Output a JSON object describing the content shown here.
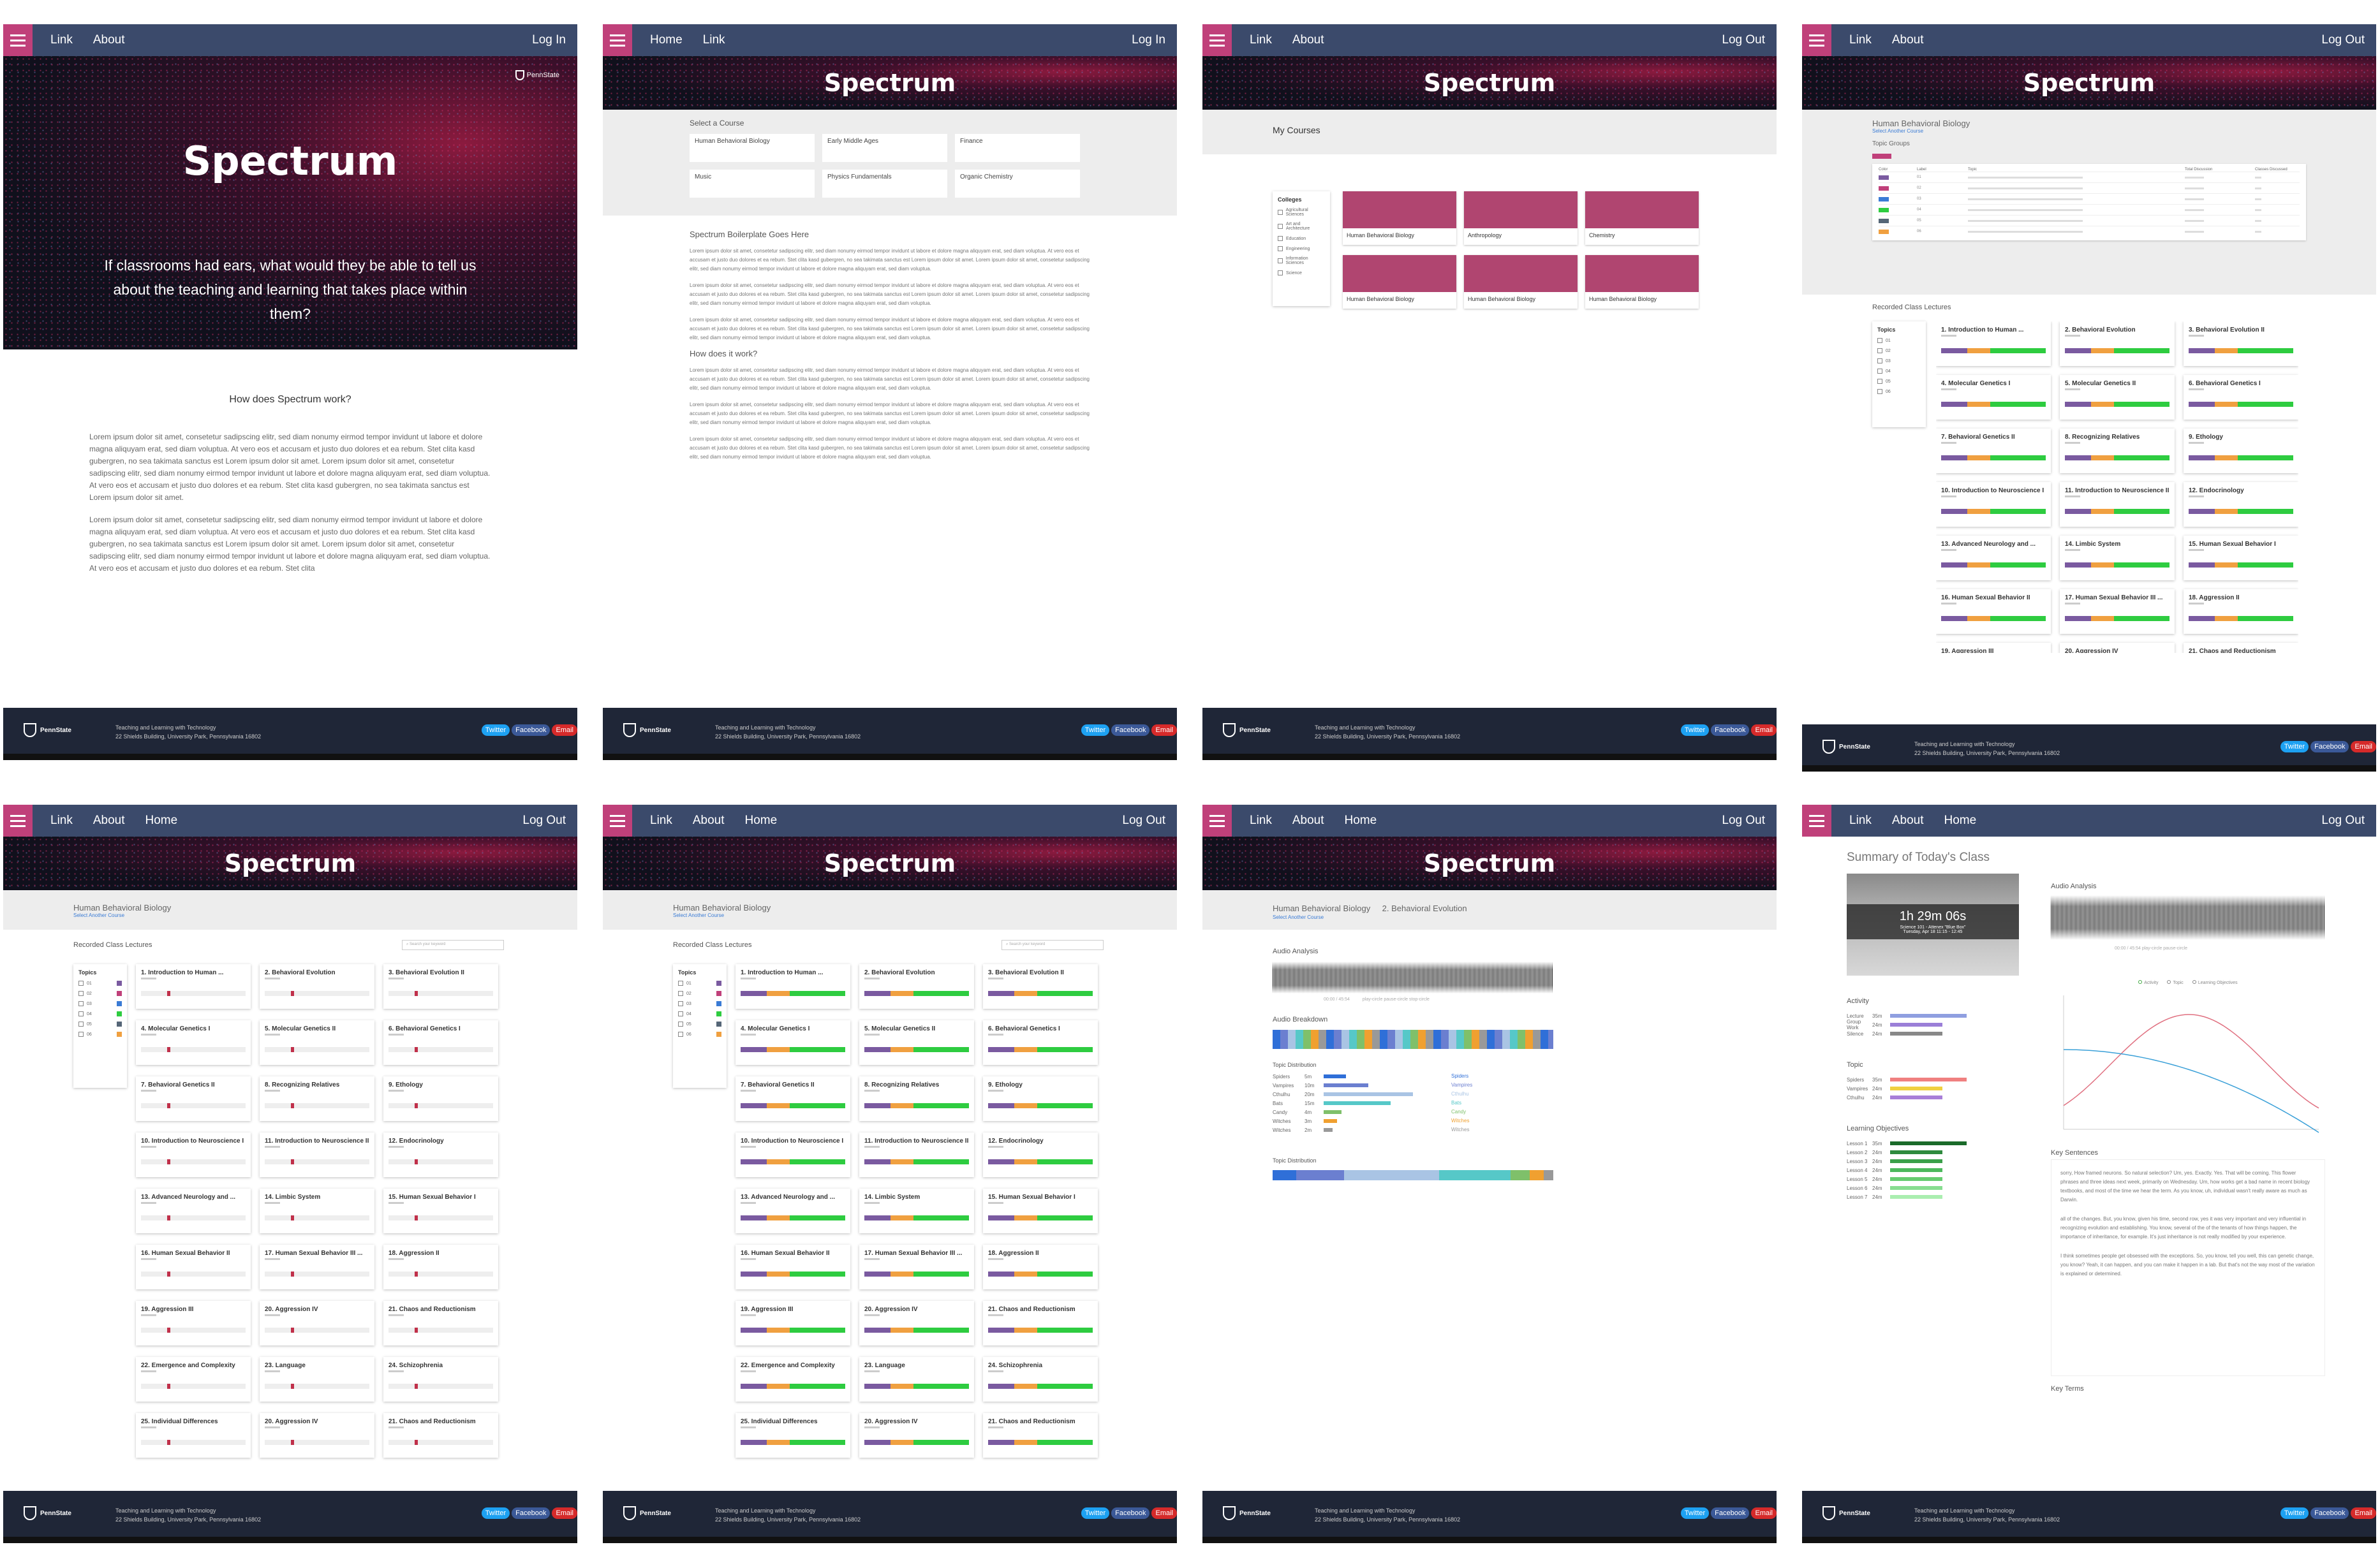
{
  "nav": {
    "link": "Link",
    "about": "About",
    "home": "Home",
    "login": "Log In",
    "logout": "Log Out"
  },
  "brand": {
    "title": "Spectrum",
    "psu": "PennState"
  },
  "hero": {
    "tagline": "If classrooms had ears, what would they be able to tell us about the teaching and learning that takes place within them?"
  },
  "landing": {
    "how_heading": "How does Spectrum work?",
    "para": "Lorem ipsum dolor sit amet, consetetur sadipscing elitr, sed diam nonumy eirmod tempor invidunt ut labore et dolore magna aliquyam erat, sed diam voluptua. At vero eos et accusam et justo duo dolores et ea rebum. Stet clita kasd gubergren, no sea takimata sanctus est Lorem ipsum dolor sit amet. Lorem ipsum dolor sit amet, consetetur sadipscing elitr, sed diam nonumy eirmod tempor invidunt ut labore et dolore magna aliquyam erat, sed diam voluptua. At vero eos et accusam et justo duo dolores et ea rebum. Stet clita kasd gubergren, no sea takimata sanctus est Lorem ipsum dolor sit amet.",
    "para2": "Lorem ipsum dolor sit amet, consetetur sadipscing elitr, sed diam nonumy eirmod tempor invidunt ut labore et dolore magna aliquyam erat, sed diam voluptua. At vero eos et accusam et justo duo dolores et ea rebum. Stet clita kasd gubergren, no sea takimata sanctus est Lorem ipsum dolor sit amet. Lorem ipsum dolor sit amet, consetetur sadipscing elitr, sed diam nonumy eirmod tempor invidunt ut labore et dolore magna aliquyam erat, sed diam voluptua. At vero eos et accusam et justo duo dolores et ea rebum. Stet clita"
  },
  "courses": {
    "select_label": "Select a Course",
    "items": [
      "Human Behavioral Biology",
      "Early Middle Ages",
      "Finance",
      "Music",
      "Physics Fundamentals",
      "Organic Chemistry"
    ],
    "boiler_heading": "Spectrum Boilerplate Goes Here",
    "how_heading": "How does it work?",
    "lorem": "Lorem ipsum dolor sit amet, consetetur sadipscing elitr, sed diam nonumy eirmod tempor invidunt ut labore et dolore magna aliquyam erat, sed diam voluptua. At vero eos et accusam et justo duo dolores et ea rebum. Stet clita kasd gubergren, no sea takimata sanctus est Lorem ipsum dolor sit amet. Lorem ipsum dolor sit amet, consetetur sadipscing elitr, sed diam nonumy eirmod tempor invidunt ut labore et dolore magna aliquyam erat, sed diam voluptua."
  },
  "mycourses": {
    "title": "My Courses",
    "colleges_label": "Colleges",
    "colleges": [
      "Agricultural Sciences",
      "Art and Architecture",
      "Education",
      "Engineering",
      "Information Sciences",
      "Science"
    ],
    "cards": [
      "Human Behavioral Biology",
      "Anthropology",
      "Chemistry",
      "Human Behavioral Biology",
      "Human Behavioral Biology",
      "Human Behavioral Biology"
    ]
  },
  "course": {
    "title": "Human Behavioral Biology",
    "sub": "Select Another Course",
    "topic_groups": "Topic Groups",
    "recorded": "Recorded Class Lectures",
    "topics_label": "Topics",
    "search_placeholder": "Search your keyword",
    "topic_codes": [
      "01",
      "02",
      "03",
      "04",
      "05",
      "06"
    ],
    "table_headers": [
      "Color",
      "Label",
      "Topic",
      "Total Discussion",
      "Classes Discussed"
    ]
  },
  "lectures": [
    "1. Introduction to Human ...",
    "2. Behavioral Evolution",
    "3. Behavioral Evolution II",
    "4. Molecular Genetics I",
    "5. Molecular Genetics II",
    "6. Behavioral Genetics I",
    "7. Behavioral Genetics II",
    "8. Recognizing Relatives",
    "9. Ethology",
    "10. Introduction to Neuroscience I",
    "11. Introduction to Neuroscience II",
    "12. Endocrinology",
    "13. Advanced Neurology and ...",
    "14. Limbic System",
    "15. Human Sexual Behavior I",
    "16. Human Sexual Behavior II",
    "17. Human Sexual Behavior III ...",
    "18. Aggression II",
    "19. Aggression III",
    "20. Aggression IV",
    "21. Chaos and Reductionism",
    "22. Emergence and Complexity",
    "23. Language",
    "24. Schizophrenia",
    "25. Individual Differences",
    "20. Aggression IV",
    "21. Chaos and Reductionism"
  ],
  "lecture": {
    "crumb2": "2. Behavioral Evolution",
    "audio_analysis": "Audio Analysis",
    "audio_breakdown": "Audio Breakdown",
    "topic_distribution": "Topic Distribution",
    "timecode": "00:00 / 45:54",
    "controls": "play-circle pause-circle stop-circle",
    "topics": [
      {
        "name": "Spiders",
        "time": "5m",
        "color": "#2f6fd8",
        "value": 5
      },
      {
        "name": "Vampires",
        "time": "10m",
        "color": "#6b7fd0",
        "value": 10
      },
      {
        "name": "Cthulhu",
        "time": "20m",
        "color": "#a9c4e4",
        "value": 20
      },
      {
        "name": "Bats",
        "time": "15m",
        "color": "#56c8c8",
        "value": 15
      },
      {
        "name": "Candy",
        "time": "4m",
        "color": "#7fc06a",
        "value": 4
      },
      {
        "name": "Witches",
        "time": "3m",
        "color": "#f0a030",
        "value": 3
      },
      {
        "name": "Witches",
        "time": "2m",
        "color": "#999999",
        "value": 2
      }
    ]
  },
  "summary": {
    "title": "Summary of Today's Class",
    "duration": "1h 29m 06s",
    "room": "Science 101 - Attenex \"Blue Box\"",
    "date": "Tuesday, Apr 18 11:15 - 12:45",
    "audio_analysis": "Audio Analysis",
    "controls": "00:00 / 45:54     play-circle     pause-circle",
    "activity": "Activity",
    "topic": "Topic",
    "learning_objectives": "Learning Objectives",
    "key_sentences": "Key Sentences",
    "key_terms": "Key Terms",
    "legend": [
      "Activity",
      "Topic",
      "Learning Objectives"
    ],
    "activity_rows": [
      {
        "label": "Lecture",
        "time": "35m",
        "color": "#8f9fe0",
        "value": 35
      },
      {
        "label": "Group Work",
        "time": "24m",
        "color": "#9b7fd8",
        "value": 24
      },
      {
        "label": "Silence",
        "time": "24m",
        "color": "#888888",
        "value": 24
      }
    ],
    "topic_rows": [
      {
        "label": "Spiders",
        "time": "35m",
        "color": "#f08080",
        "value": 35
      },
      {
        "label": "Vampires",
        "time": "24m",
        "color": "#f0d040",
        "value": 24
      },
      {
        "label": "Cthulhu",
        "time": "24m",
        "color": "#a87fd8",
        "value": 24
      }
    ],
    "lo_rows": [
      {
        "label": "Lesson 1",
        "time": "35m",
        "color": "#1a6b2a",
        "value": 35
      },
      {
        "label": "Lesson 2",
        "time": "24m",
        "color": "#2e8b3e",
        "value": 24
      },
      {
        "label": "Lesson 3",
        "time": "24m",
        "color": "#3aa04a",
        "value": 24
      },
      {
        "label": "Lesson 4",
        "time": "24m",
        "color": "#4cb85c",
        "value": 24
      },
      {
        "label": "Lesson 5",
        "time": "24m",
        "color": "#66cc70",
        "value": 24
      },
      {
        "label": "Lesson 6",
        "time": "24m",
        "color": "#88dd90",
        "value": 24
      },
      {
        "label": "Lesson 7",
        "time": "24m",
        "color": "#aaeeb0",
        "value": 24
      }
    ],
    "sentences": "sorry, How framed neurons. So natural selection? Um, yes. Exactly. Yes. That will be coming. This flower phrases and three ideas next week, primarily on Wednesday. Um, how works get a bad name in recent biology textbooks, and most of the time we hear the term. As you know, uh, individual wasn't really aware as much as Darwin.",
    "sentences2": "all of the changes. But, you know, given his time, second row, yes it was very important and very influential in recognizing evolution and establishing. You know, several of the of the tenants of how things happen, the importance of inheritance, for example. It's just inheritance is not really modified by your experience.",
    "sentences3": "I think sometimes people get obsessed with the exceptions. So, you know, tell you well, this can genetic change, you know? Yeah, it can happen, and you can make it happen in a lab. But that's not the way most of the variation is explained or determined."
  },
  "footer": {
    "line1": "Teaching and Learning with Technology",
    "line2": "22 Shields Building, University Park, Pennsylvania 16802",
    "twitter": "Twitter",
    "facebook": "Facebook",
    "email": "Email"
  },
  "colors": {
    "nav": "#3b4a6b",
    "accent": "#c0407a",
    "footer": "#1f2637",
    "course_card": "#b04570"
  }
}
